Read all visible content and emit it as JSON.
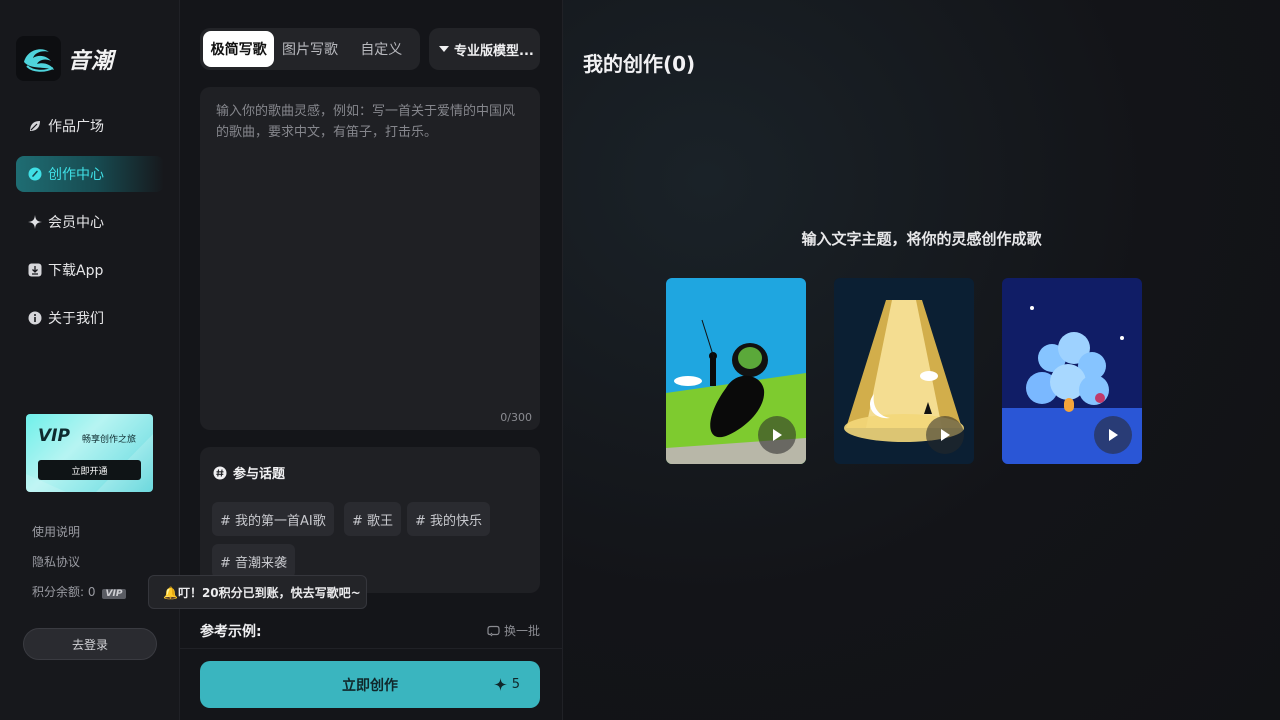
{
  "app": {
    "name": "音潮"
  },
  "sidebar": {
    "items": [
      {
        "label": "作品广场",
        "icon": "leaf-icon"
      },
      {
        "label": "创作中心",
        "icon": "pen-circle-icon",
        "active": true
      },
      {
        "label": "会员中心",
        "icon": "sparkle-icon"
      },
      {
        "label": "下载App",
        "icon": "download-icon"
      },
      {
        "label": "关于我们",
        "icon": "info-icon"
      }
    ],
    "vip_card": {
      "title": "VIP",
      "subtitle": "畅享创作之旅",
      "button": "立即开通"
    },
    "links": {
      "usage": "使用说明",
      "privacy": "隐私协议",
      "points_label": "积分余额: 0",
      "vip_tag": "VIP"
    },
    "login_button": "去登录"
  },
  "creator": {
    "tabs": [
      {
        "label": "极简写歌",
        "active": true
      },
      {
        "label": "图片写歌"
      },
      {
        "label": "自定义"
      }
    ],
    "model_select": "专业版模型...",
    "prompt": {
      "value": "",
      "placeholder": "输入你的歌曲灵感，例如：写一首关于爱情的中国风的歌曲，要求中文，有笛子，打击乐。",
      "counter": "0/300"
    },
    "topics": {
      "heading": "参与话题",
      "chips": [
        "# 我的第一首AI歌",
        "# 歌王",
        "# 我的快乐",
        "# 音潮来袭"
      ]
    },
    "reference": {
      "title": "参考示例:",
      "refresh": "换一批"
    },
    "create_button": {
      "label": "立即创作",
      "cost": "5"
    }
  },
  "toast": {
    "text": "🔔叮！20积分已到账，快去写歌吧~"
  },
  "works": {
    "title": "我的创作(0)",
    "empty_tip": "输入文字主题，将你的灵感创作成歌",
    "examples": [
      {
        "name": "example-card-tree"
      },
      {
        "name": "example-card-lamp"
      },
      {
        "name": "example-card-snow"
      }
    ]
  },
  "colors": {
    "accent": "#3ab5bf",
    "active_nav_text": "#3fe0e6",
    "background": "#121317"
  }
}
